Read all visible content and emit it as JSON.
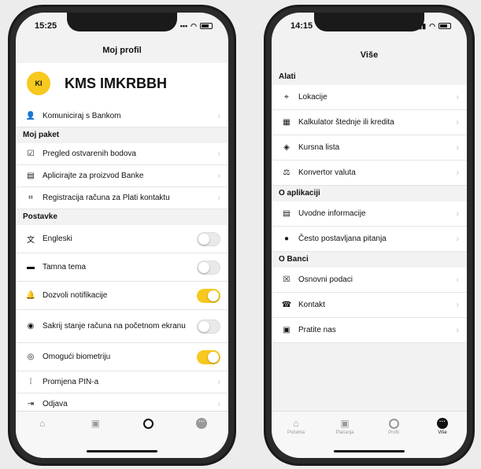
{
  "left": {
    "time": "15:25",
    "title": "Moj profil",
    "profile": {
      "initials": "KI",
      "name": "KMS IMKRBBH"
    },
    "communicate": "Komuniciraj s Bankom",
    "sections": [
      {
        "title": "Moj paket",
        "items": [
          "Pregled ostvarenih bodova",
          "Aplicirajte za proizvod Banke",
          "Registracija računa za Plati kontaktu"
        ]
      },
      {
        "title": "Postavke"
      }
    ],
    "settings": [
      {
        "label": "Engleski",
        "on": false
      },
      {
        "label": "Tamna tema",
        "on": false
      },
      {
        "label": "Dozvoli notifikacije",
        "on": true
      },
      {
        "label": "Sakrij stanje računa na početnom ekranu",
        "on": false
      },
      {
        "label": "Omogući biometriju",
        "on": true
      }
    ],
    "links": [
      "Promjena PIN-a",
      "Odjava"
    ]
  },
  "right": {
    "time": "14:15",
    "title": "Više",
    "sections": [
      {
        "title": "Alati",
        "items": [
          "Lokacije",
          "Kalkulator štednje ili kredita",
          "Kursna lista",
          "Konvertor valuta"
        ]
      },
      {
        "title": "O aplikaciji",
        "items": [
          "Uvodne informacije",
          "Često postavljana pitanja"
        ]
      },
      {
        "title": "O Banci",
        "items": [
          "Osnovni podaci",
          "Kontakt",
          "Pratite nas"
        ]
      }
    ],
    "tabs": [
      "Početna",
      "Plaćanja",
      "Profil",
      "Više"
    ]
  },
  "colors": {
    "accent": "#f7c81e"
  }
}
